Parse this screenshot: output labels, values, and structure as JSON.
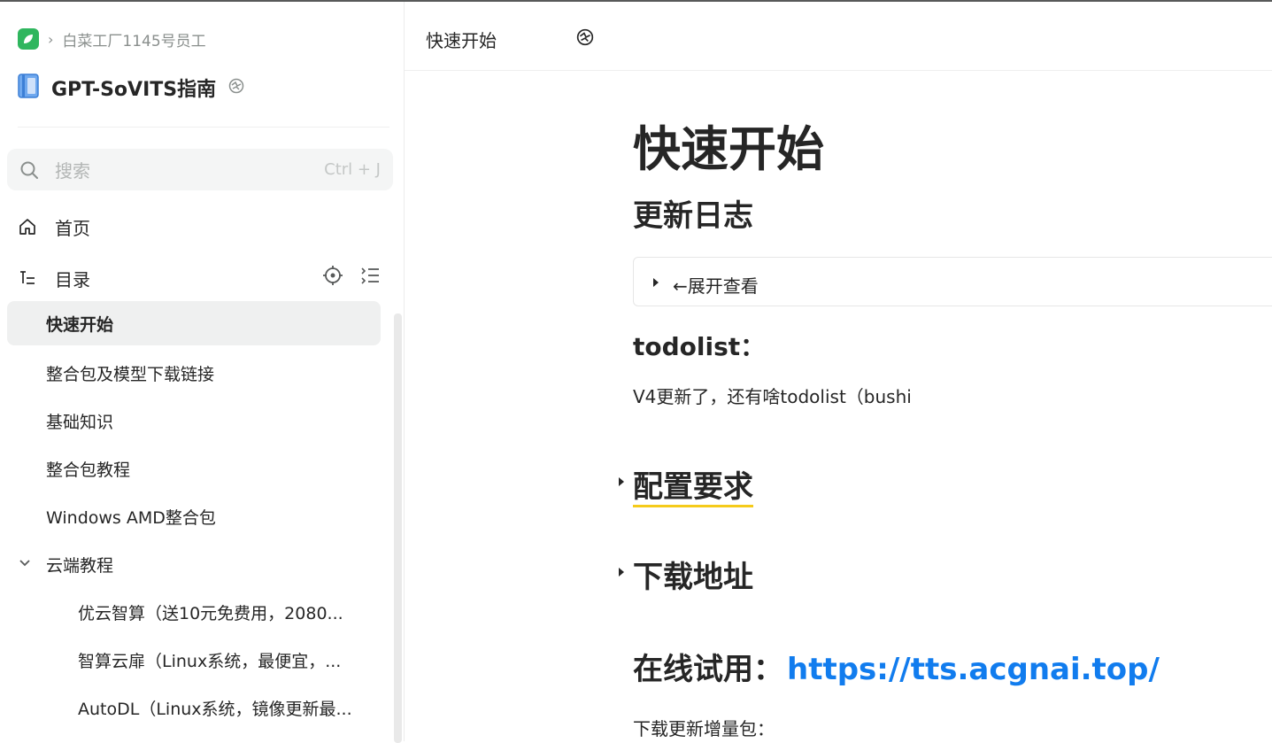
{
  "breadcrumb": {
    "org": "白菜工厂1145号员工"
  },
  "book": {
    "title": "GPT-SoVITS指南"
  },
  "search": {
    "placeholder": "搜索",
    "shortcut": "Ctrl + J"
  },
  "nav": {
    "home": "首页",
    "toc": "目录"
  },
  "tree": [
    {
      "label": "快速开始",
      "level": 1,
      "active": true
    },
    {
      "label": "整合包及模型下载链接",
      "level": 1
    },
    {
      "label": "基础知识",
      "level": 1
    },
    {
      "label": "整合包教程",
      "level": 1
    },
    {
      "label": "Windows AMD整合包",
      "level": 1
    },
    {
      "label": "云端教程",
      "level": 1,
      "expanded": true
    },
    {
      "label": "优云智算（送10元免费用，2080...",
      "level": 2
    },
    {
      "label": "智算云扉（Linux系统，最便宜，...",
      "level": 2
    },
    {
      "label": "AutoDL（Linux系统，镜像更新最...",
      "level": 2
    }
  ],
  "header": {
    "title": "快速开始"
  },
  "doc": {
    "title": "快速开始",
    "changelog_heading": "更新日志",
    "details_summary": "←展开查看",
    "todolist_heading": "todolist：",
    "todolist_text": "V4更新了，还有啥todolist（bushi",
    "config_heading": "配置要求",
    "download_heading": "下载地址",
    "online_heading": "在线试用：",
    "online_link": "https://tts.acgnai.top/",
    "incremental_text": "下载更新增量包："
  },
  "colors": {
    "brand": "#2fb65e",
    "link": "#117cee",
    "highlight": "#f5cb1a",
    "active_bg": "#eff0f0"
  }
}
